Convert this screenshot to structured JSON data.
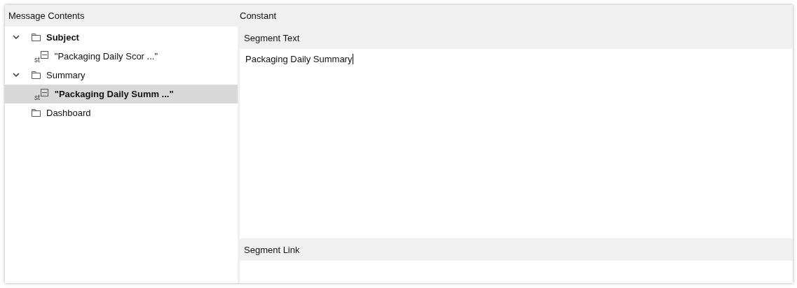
{
  "left_panel": {
    "title": "Message Contents",
    "tree": [
      {
        "kind": "folder",
        "label": "Subject",
        "emphasized": true,
        "selected": false,
        "expanded": true,
        "children": [
          {
            "kind": "string",
            "type_tag": "st",
            "label": "\"Packaging Daily Scor ...\"",
            "emphasized": false,
            "selected": false
          }
        ]
      },
      {
        "kind": "folder",
        "label": "Summary",
        "emphasized": false,
        "selected": false,
        "expanded": true,
        "children": [
          {
            "kind": "string",
            "type_tag": "st",
            "label": "\"Packaging Daily Summ ...\"",
            "emphasized": true,
            "selected": true
          }
        ]
      },
      {
        "kind": "folder",
        "label": "Dashboard",
        "emphasized": false,
        "selected": false
      }
    ]
  },
  "right_panel": {
    "title": "Constant",
    "sections": [
      {
        "label": "Segment Text",
        "value": "Packaging Daily Summary",
        "focused": true
      },
      {
        "label": "Segment Link",
        "focused": false
      }
    ]
  }
}
